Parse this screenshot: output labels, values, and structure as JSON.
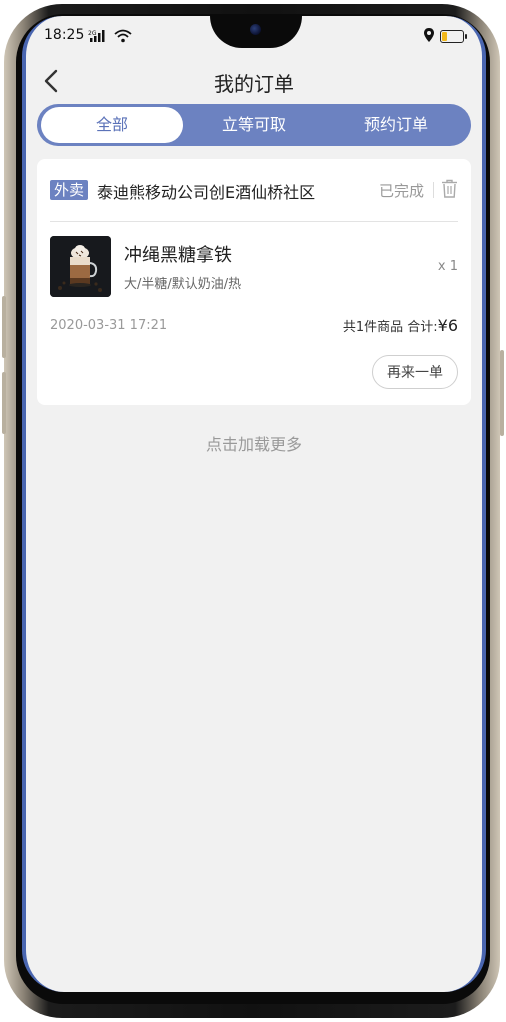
{
  "status_bar": {
    "time": "18:25",
    "network": "2G"
  },
  "header": {
    "title": "我的订单",
    "back_icon": "chevron-left-icon"
  },
  "tabs": [
    {
      "label": "全部",
      "active": true
    },
    {
      "label": "立等可取",
      "active": false
    },
    {
      "label": "预约订单",
      "active": false
    }
  ],
  "order": {
    "type_badge": "外卖",
    "store": "泰迪熊移动公司创E酒仙桥社区",
    "status": "已完成",
    "item": {
      "name": "冲绳黑糖拿铁",
      "spec": "大/半糖/默认奶油/热",
      "qty": "x 1"
    },
    "date": "2020-03-31 17:21",
    "summary_prefix": "共1件商品 合计:",
    "total": "¥6",
    "reorder_label": "再来一单"
  },
  "load_more": "点击加载更多",
  "colors": {
    "accent": "#6c82c1",
    "background": "#f1f1f1"
  }
}
